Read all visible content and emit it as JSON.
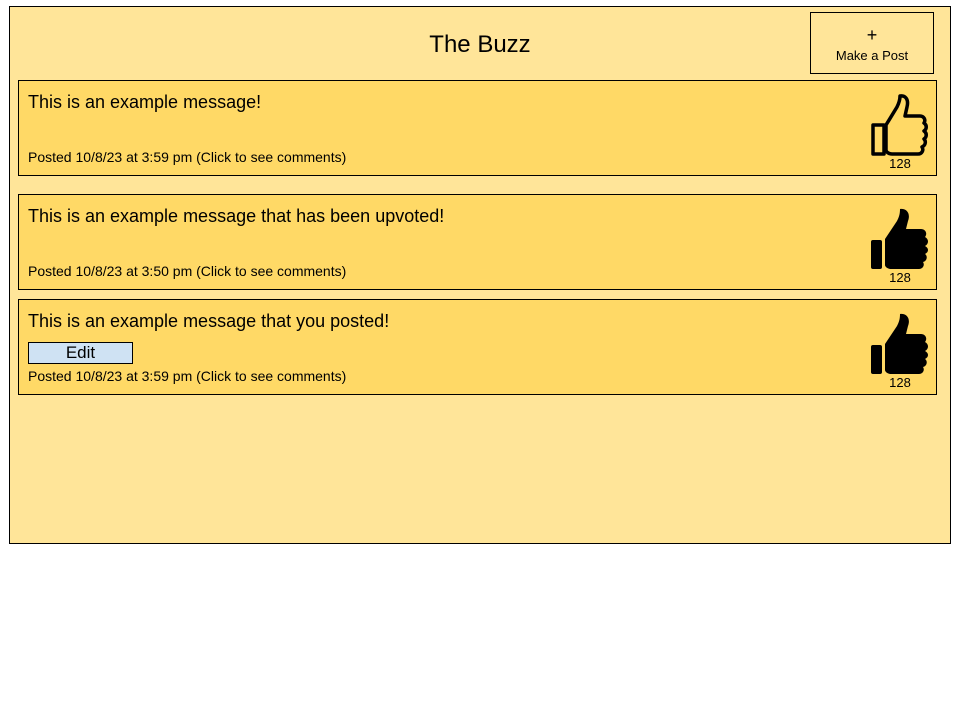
{
  "header": {
    "title": "The Buzz",
    "make_post": {
      "icon": "plus-icon",
      "symbol": "+",
      "label": "Make a Post"
    }
  },
  "posts": [
    {
      "message": "This is an example message!",
      "meta": "Posted 10/8/23 at 3:59 pm (Click to see comments)",
      "likes": "128",
      "liked": false,
      "icon": "thumbs-up-outline-icon",
      "editable": false
    },
    {
      "message": "This is an example message that has been upvoted!",
      "meta": "Posted 10/8/23 at 3:50 pm (Click to see comments)",
      "likes": "128",
      "liked": true,
      "icon": "thumbs-up-filled-icon",
      "editable": false
    },
    {
      "message": "This is an example message that you posted!",
      "edit_label": "Edit",
      "meta": "Posted 10/8/23 at 3:59 pm (Click to see comments)",
      "likes": "128",
      "liked": true,
      "icon": "thumbs-up-filled-icon",
      "editable": true
    }
  ],
  "colors": {
    "app_background": "#ffe599",
    "post_background": "#ffd966",
    "edit_button": "#cfe2f3",
    "border": "#000000"
  }
}
